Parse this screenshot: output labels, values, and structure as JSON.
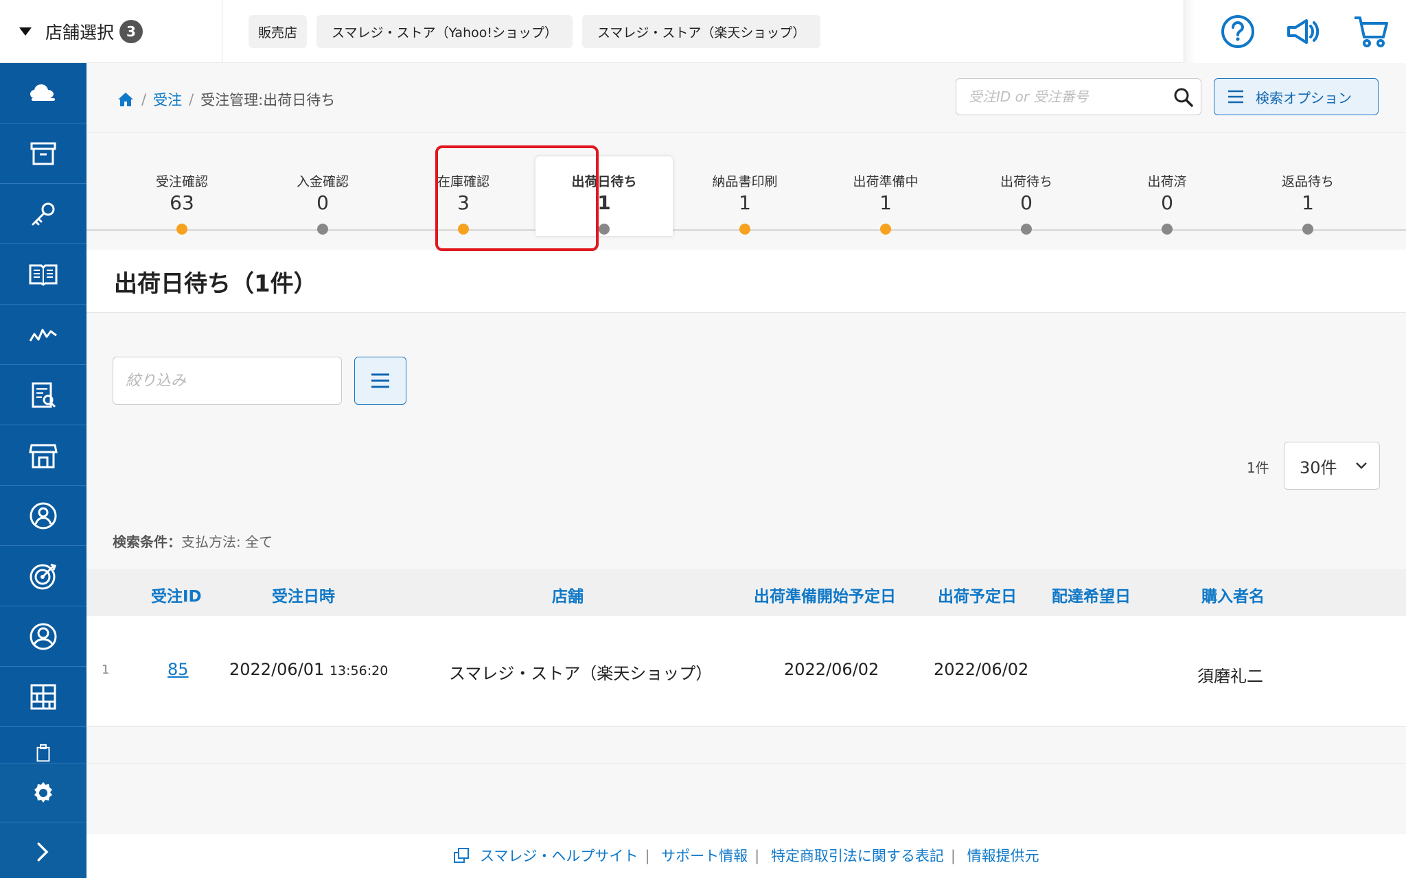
{
  "header": {
    "store_select_label": "店舗選択",
    "store_count": "3",
    "chips": [
      "販売店",
      "スマレジ・ストア（Yahoo!ショップ）",
      "スマレジ・ストア（楽天ショップ）"
    ]
  },
  "breadcrumb": {
    "items": [
      "受注",
      "受注管理:出荷日待ち"
    ]
  },
  "search": {
    "placeholder": "受注ID or 受注番号",
    "options_label": "検索オプション"
  },
  "tabs": [
    {
      "label": "受注確認",
      "count": "63",
      "dot": "orange"
    },
    {
      "label": "入金確認",
      "count": "0",
      "dot": "gray"
    },
    {
      "label": "在庫確認",
      "count": "3",
      "dot": "orange"
    },
    {
      "label": "出荷日待ち",
      "count": "1",
      "dot": "gray",
      "active": true
    },
    {
      "label": "納品書印刷",
      "count": "1",
      "dot": "orange"
    },
    {
      "label": "出荷準備中",
      "count": "1",
      "dot": "orange"
    },
    {
      "label": "出荷待ち",
      "count": "0",
      "dot": "gray"
    },
    {
      "label": "出荷済",
      "count": "0",
      "dot": "gray"
    },
    {
      "label": "返品待ち",
      "count": "1",
      "dot": "gray"
    }
  ],
  "page": {
    "title": "出荷日待ち（1件）"
  },
  "filter": {
    "placeholder": "絞り込み",
    "count_text": "1件",
    "per_page": "30件"
  },
  "conditions": {
    "label": "検索条件：",
    "value": "支払方法: 全て"
  },
  "table": {
    "headers": [
      "受注ID",
      "受注日時",
      "店舗",
      "出荷準備開始予定日",
      "出荷予定日",
      "配達希望日",
      "購入者名"
    ],
    "rows": [
      {
        "index": "1",
        "order_id": "85",
        "date": "2022/06/01",
        "time": "13:56:20",
        "store": "スマレジ・ストア（楽天ショップ）",
        "prep_date": "2022/06/02",
        "ship_date": "2022/06/02",
        "delivery_date": "",
        "buyer": "須磨礼二"
      }
    ]
  },
  "footer": {
    "links": [
      "スマレジ・ヘルプサイト",
      "サポート情報",
      "特定商取引法に関する表記",
      "情報提供元"
    ]
  },
  "colors": {
    "sidebar": "#0a5aa0",
    "accent": "#0f78c8",
    "orange": "#f6a21e",
    "highlight": "#e1171e"
  },
  "icons": {
    "sidebar": [
      "cloud-icon",
      "box-icon",
      "key-icon",
      "book-icon",
      "chart-icon",
      "report-icon",
      "store-icon",
      "user-card-icon",
      "target-icon",
      "user-icon",
      "grid-icon",
      "clipboard-icon"
    ],
    "top_right": [
      "help-icon",
      "megaphone-icon",
      "cart-icon"
    ]
  }
}
